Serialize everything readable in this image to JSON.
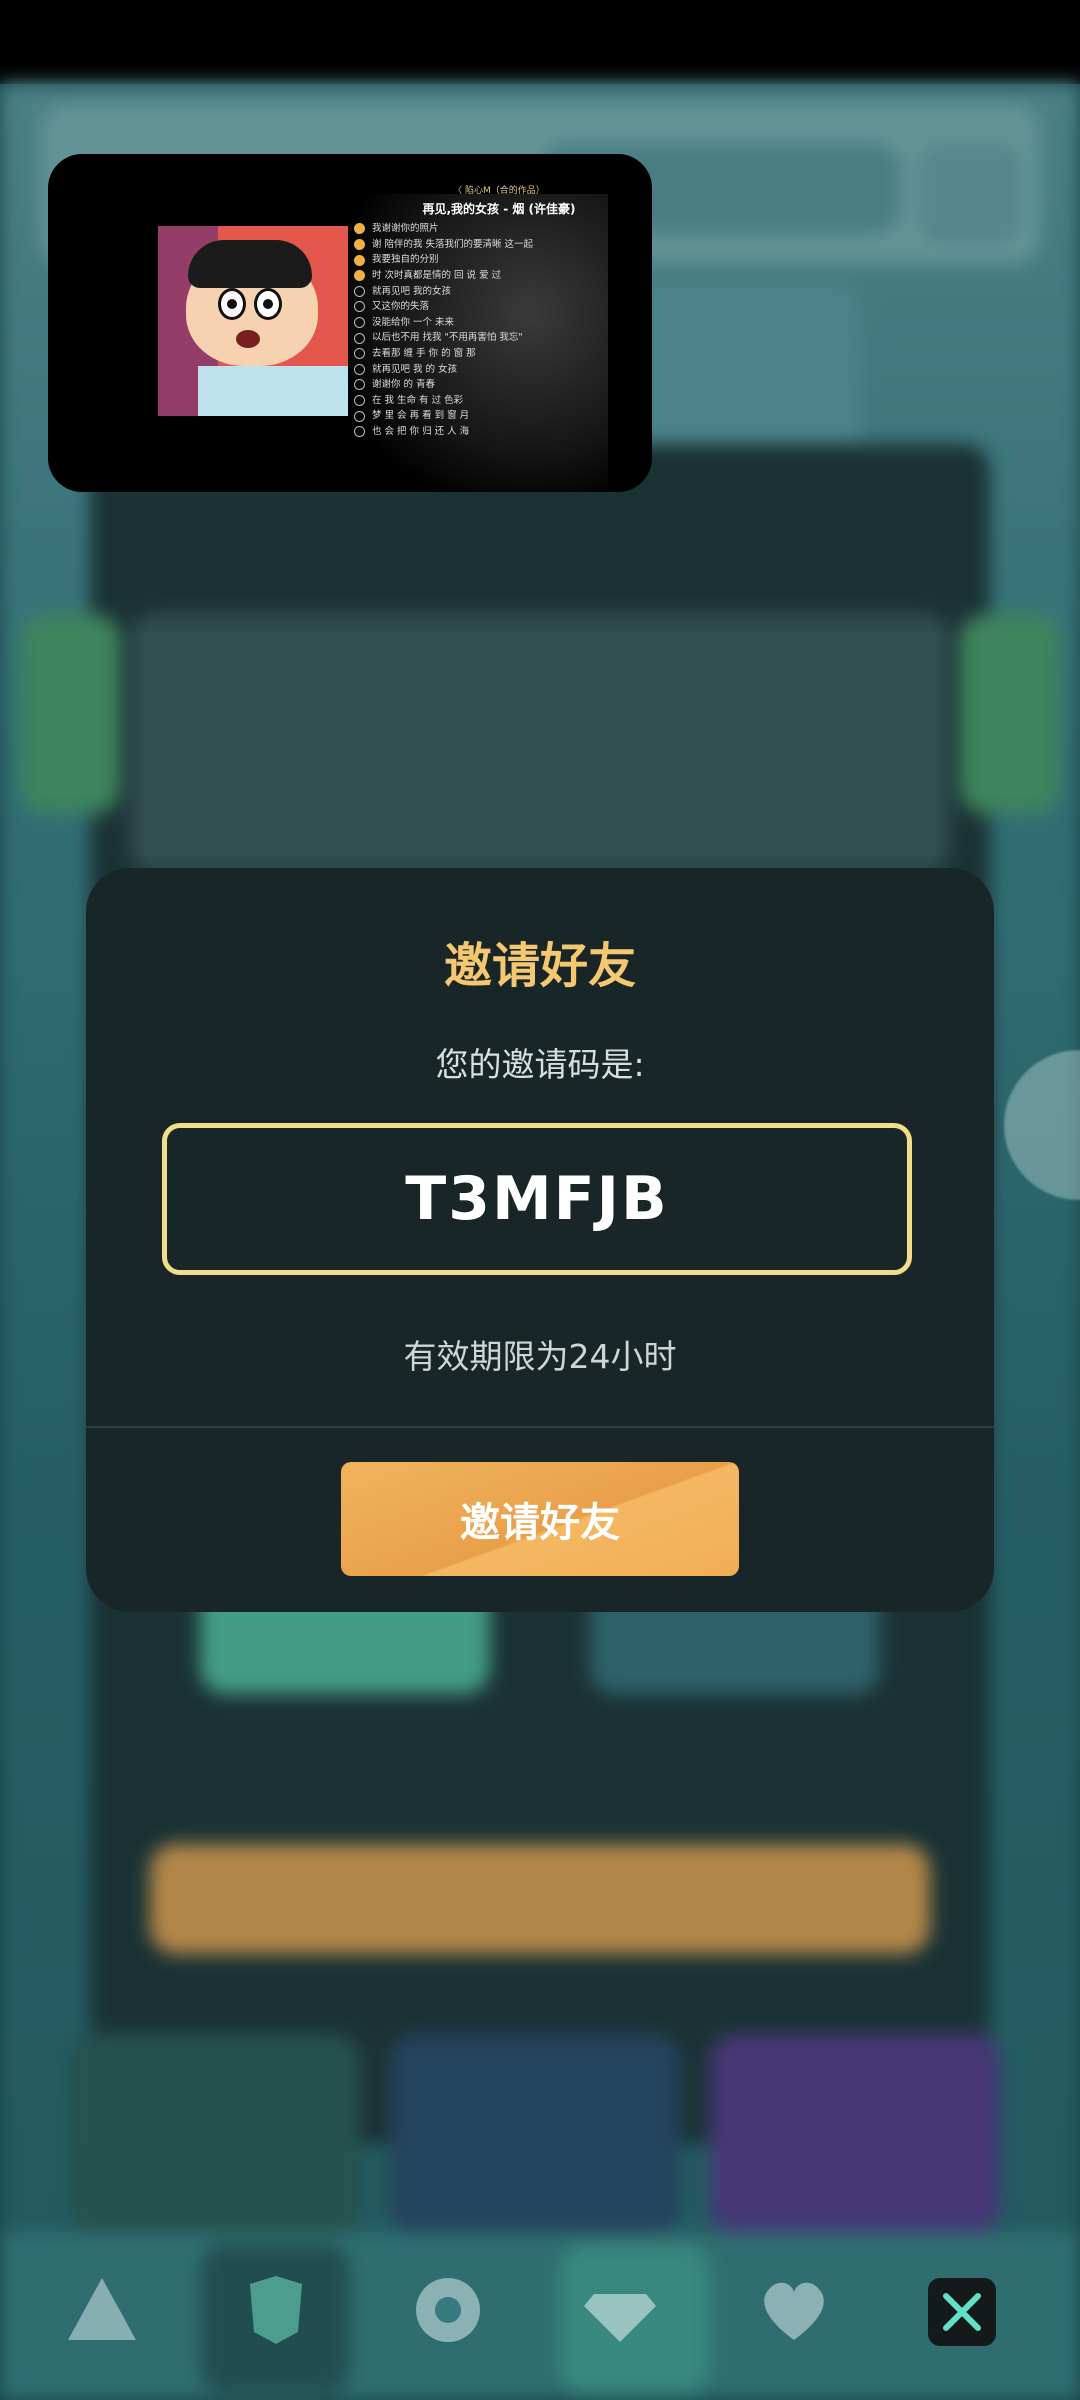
{
  "dialog": {
    "title": "邀请好友",
    "subtitle": "您的邀请码是:",
    "code": "T3MFJB",
    "validity": "有效期限为24小时",
    "button_label": "邀请好友"
  },
  "mini_player": {
    "header": "〈 陷心M（合的作品）",
    "song_title": "再见,我的女孩 - 烟 (许佳豪)",
    "lyrics": [
      {
        "text": "我谢谢你的照片",
        "done": true
      },
      {
        "text": "谢 陪伴的我 失落我们的要清晰 这一起",
        "done": true
      },
      {
        "text": "我要独自的分别",
        "done": true
      },
      {
        "text": "时 次时真都是情的 回 说 爱 过",
        "done": true
      },
      {
        "text": "就再见吧 我的女孩",
        "done": false
      },
      {
        "text": "又这你的失落",
        "done": false
      },
      {
        "text": "没能给你 一个 未来",
        "done": false
      },
      {
        "text": "以后也不用 找我 \"不用再害怕 我忘\"",
        "done": false
      },
      {
        "text": "去看那 缠 手 你 的 窗 那",
        "done": false
      },
      {
        "text": "就再见吧 我 的 女孩",
        "done": false
      },
      {
        "text": "谢谢你 的 青春",
        "done": false
      },
      {
        "text": "在 我 生命 有 过 色彩",
        "done": false
      },
      {
        "text": "梦 里 会 再 看 到 窗 月",
        "done": false
      },
      {
        "text": "也 会 把 你 归 还 人 海",
        "done": false
      }
    ]
  },
  "colors": {
    "accent_gold": "#f6c771",
    "button_orange": "#f0ad56",
    "dialog_bg": "#182627"
  },
  "icons": [
    "triangle-icon",
    "badge-icon",
    "gear-icon",
    "diamond-icon",
    "heart-icon",
    "close-icon"
  ]
}
